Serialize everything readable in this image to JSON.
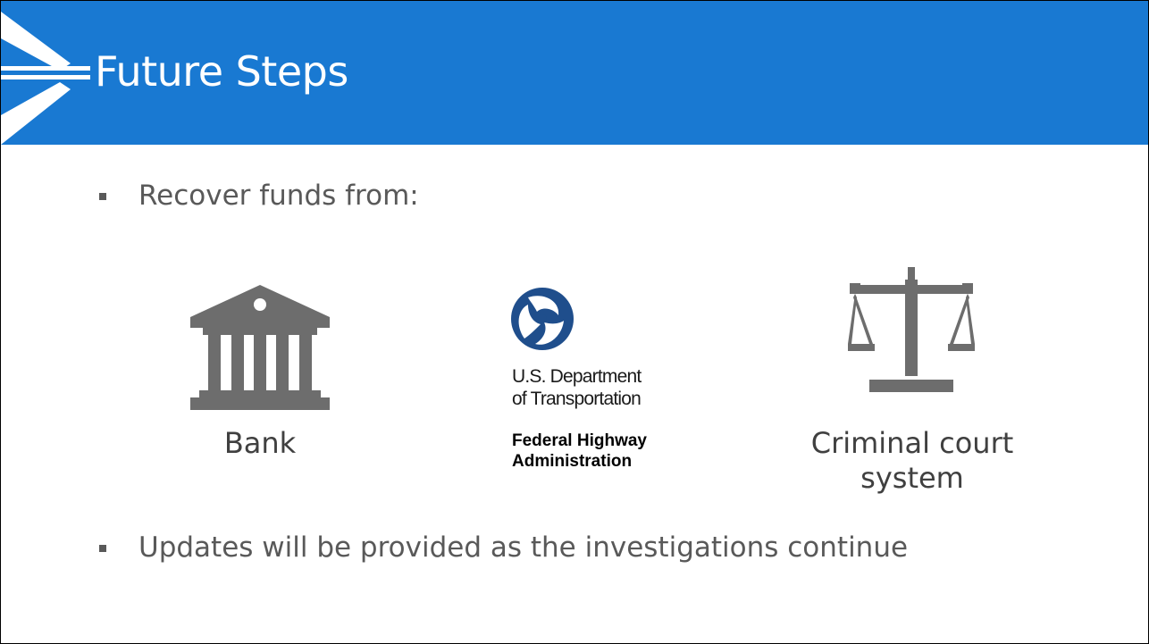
{
  "slide": {
    "title": "Future Steps",
    "bullets": [
      "Recover funds from:",
      "Updates will be provided as the investigations continue"
    ],
    "items": [
      {
        "icon": "bank-building-icon",
        "caption": "Bank"
      },
      {
        "icon": "usdot-logo-icon",
        "dept_line1": "U.S. Department",
        "dept_line2": "of Transportation",
        "admin_line1": "Federal Highway",
        "admin_line2": "Administration"
      },
      {
        "icon": "scales-of-justice-icon",
        "caption_line1": "Criminal court",
        "caption_line2": "system"
      }
    ]
  },
  "colors": {
    "accent": "#1979d2",
    "icon_gray": "#6d6d6d",
    "dot_blue": "#1f4e8c"
  }
}
